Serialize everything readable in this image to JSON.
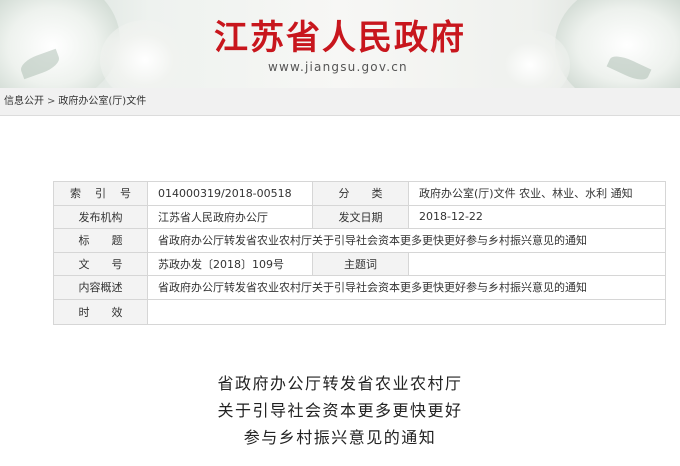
{
  "header": {
    "site_name": "江苏省人民政府",
    "site_url": "www.jiangsu.gov.cn",
    "brand_color": "#c8161d"
  },
  "breadcrumb": {
    "items": [
      "信息公开",
      "政府办公室(厅)文件"
    ],
    "separator": ">"
  },
  "info_table": {
    "index_label": "索引号",
    "index_value": "014000319/2018-00518",
    "category_label": "分类",
    "category_value": "政府办公室(厅)文件 农业、林业、水利 通知",
    "issuer_label": "发布机构",
    "issuer_value": "江苏省人民政府办公厅",
    "date_label": "发文日期",
    "date_value": "2018-12-22",
    "title_label": "标题",
    "title_value": "省政府办公厅转发省农业农村厅关于引导社会资本更多更快更好参与乡村振兴意见的通知",
    "docno_label": "文号",
    "docno_value": "苏政办发〔2018〕109号",
    "subject_label": "主题词",
    "subject_value": "",
    "summary_label": "内容概述",
    "summary_value": "省政府办公厅转发省农业农村厅关于引导社会资本更多更快更好参与乡村振兴意见的通知",
    "validity_label": "时效",
    "validity_value": ""
  },
  "document": {
    "title_line1": "省政府办公厅转发省农业农村厅",
    "title_line2": "关于引导社会资本更多更快更好",
    "title_line3": "参与乡村振兴意见的通知"
  }
}
